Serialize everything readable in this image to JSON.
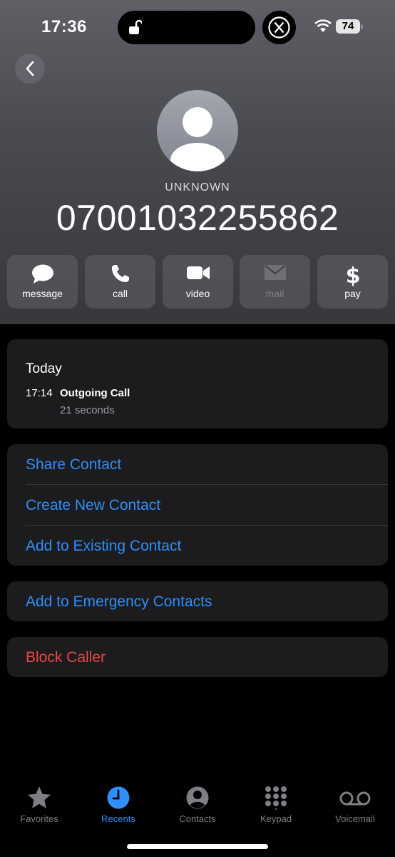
{
  "status_bar": {
    "time": "17:36",
    "battery": "74"
  },
  "caller": {
    "label": "UNKNOWN",
    "number": "07001032255862"
  },
  "actions": [
    {
      "label": "message",
      "icon": "message-icon",
      "enabled": true
    },
    {
      "label": "call",
      "icon": "phone-icon",
      "enabled": true
    },
    {
      "label": "video",
      "icon": "video-camera-icon",
      "enabled": true
    },
    {
      "label": "mail",
      "icon": "envelope-icon",
      "enabled": false
    },
    {
      "label": "pay",
      "icon": "dollar-icon",
      "enabled": true
    }
  ],
  "history": {
    "day": "Today",
    "time": "17:14",
    "type": "Outgoing Call",
    "duration": "21 seconds"
  },
  "contact_options": [
    "Share Contact",
    "Create New Contact",
    "Add to Existing Contact"
  ],
  "emergency_option": "Add to Emergency Contacts",
  "block_option": "Block Caller",
  "tabs": [
    {
      "label": "Favorites",
      "icon": "star-icon",
      "active": false
    },
    {
      "label": "Recents",
      "icon": "clock-icon",
      "active": true
    },
    {
      "label": "Contacts",
      "icon": "person-circle-icon",
      "active": false
    },
    {
      "label": "Keypad",
      "icon": "keypad-icon",
      "active": false
    },
    {
      "label": "Voicemail",
      "icon": "voicemail-icon",
      "active": false
    }
  ],
  "colors": {
    "accent": "#2e8ff9",
    "destructive": "#ee4640",
    "card": "#1c1c1e"
  }
}
